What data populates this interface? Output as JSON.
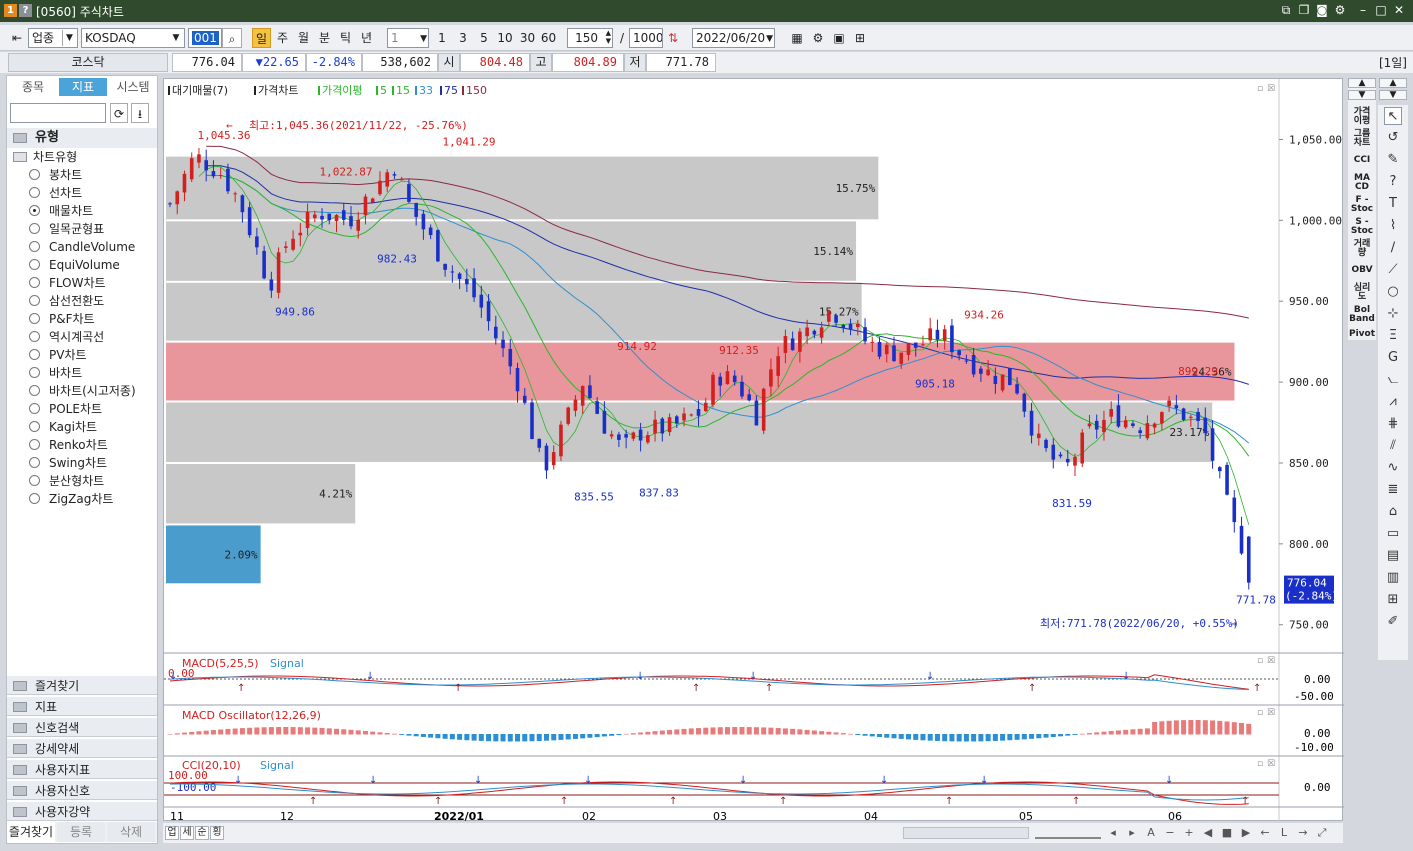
{
  "window": {
    "title": "[0560] 주식차트",
    "badge1": "1",
    "badge2": "?"
  },
  "toolbar": {
    "market_type": "업종",
    "symbol": "KOSDAQ",
    "code": "001",
    "periods": [
      "일",
      "주",
      "월",
      "분",
      "틱",
      "년"
    ],
    "active_period": "일",
    "interval_value": "1",
    "quick_intervals": [
      "1",
      "3",
      "5",
      "10",
      "30",
      "60"
    ],
    "display_count": "150",
    "total_count": "1000",
    "date": "2022/06/20",
    "slash": "/"
  },
  "quote": {
    "name": "코스닥",
    "price": "776.04",
    "change": "▼22.65",
    "change_pct": "-2.84%",
    "volume": "538,602",
    "open_label": "시",
    "open": "804.48",
    "high_label": "고",
    "high": "804.89",
    "low_label": "저",
    "low": "771.78",
    "period_badge": "[1일]"
  },
  "left": {
    "tabs": [
      "종목",
      "지표",
      "시스템"
    ],
    "active_tab": "지표",
    "section": "유형",
    "group": "차트유형",
    "chart_types": [
      "봉차트",
      "선차트",
      "매물차트",
      "일목균형표",
      "CandleVolume",
      "EquiVolume",
      "FLOW차트",
      "삼선전환도",
      "P&F차트",
      "역시계곡선",
      "PV차트",
      "바차트",
      "바차트(시고저종)",
      "POLE차트",
      "Kagi차트",
      "Renko차트",
      "Swing차트",
      "분산형차트",
      "ZigZag차트"
    ],
    "selected_type": "매물차트",
    "folders": [
      "즐겨찾기",
      "지표",
      "신호검색",
      "강세약세",
      "사용자지표",
      "사용자신호",
      "사용자강약"
    ],
    "bottom_tabs": [
      "즐겨찾기",
      "등록",
      "삭제"
    ]
  },
  "legend": {
    "items": [
      "대기매물(7)",
      "가격차트",
      "가격이평",
      "5",
      "15",
      "33",
      "75",
      "150"
    ],
    "colors": {
      "ma5": "#2db52d",
      "ma15": "#2db52d",
      "ma33": "#2f8fd1",
      "ma75": "#1d2fa8",
      "ma150": "#8b2a42"
    }
  },
  "annotations": {
    "high_note": "최고:1,045.36(2021/11/22, -25.76%)",
    "low_note": "최저:771.78(2022/06/20, +0.55%)",
    "arrow_left": "←",
    "arrow_right": "→"
  },
  "price_labels": [
    "1,045.36",
    "1,041.29",
    "1,022.87",
    "982.43",
    "949.86",
    "914.92",
    "912.35",
    "934.26",
    "905.18",
    "899.29",
    "835.55",
    "837.83",
    "831.59",
    "771.78"
  ],
  "volume_profile": [
    {
      "pct": "15.75%"
    },
    {
      "pct": "15.14%"
    },
    {
      "pct": "15.27%"
    },
    {
      "pct": "24.36%"
    },
    {
      "pct": "23.17%"
    },
    {
      "pct": "4.21%"
    },
    {
      "pct": "2.09%"
    }
  ],
  "current_price": {
    "price": "776.04",
    "pct": "(-2.84%)"
  },
  "chart_data": {
    "type": "candlestick",
    "ylim": [
      735,
      1075
    ],
    "yticks": [
      750,
      800,
      850,
      900,
      950,
      1000,
      1050
    ],
    "ytick_labels": [
      "750.00",
      "800.00",
      "850.00",
      "900.00",
      "950.00",
      "1,000.00",
      "1,050.00"
    ],
    "xtick_labels": [
      "11",
      "12",
      "2022/01",
      "02",
      "03",
      "04",
      "05",
      "06"
    ],
    "series": [
      "가격차트",
      "MA5",
      "MA15",
      "MA33",
      "MA75",
      "MA150"
    ],
    "high": {
      "value": 1045.36,
      "date": "2021/11/22"
    },
    "low": {
      "value": 771.78,
      "date": "2022/06/20"
    },
    "last": {
      "open": 804.48,
      "high": 804.89,
      "low": 771.78,
      "close": 776.04
    }
  },
  "panels": {
    "macd": {
      "label": "MACD(5,25,5)",
      "signal": "Signal",
      "ticks": [
        "0.00",
        "-50.00"
      ],
      "left_value": "0.00"
    },
    "osc": {
      "label": "MACD Oscillator(12,26,9)",
      "ticks": [
        "0.00",
        "-10.00"
      ]
    },
    "cci": {
      "label": "CCI(20,10)",
      "signal": "Signal",
      "ticks": [
        "0.00"
      ],
      "left_values": [
        "100.00",
        "-100.00"
      ]
    }
  },
  "bottombar": {
    "tabs": [
      "업",
      "세",
      "순",
      "횡"
    ]
  }
}
